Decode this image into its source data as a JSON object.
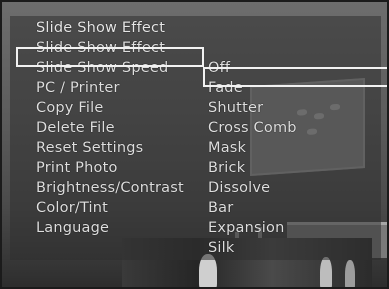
{
  "menu": {
    "title": "Slide Show Effect",
    "items": [
      {
        "label": "Slide Show Effect"
      },
      {
        "label": "Slide Show Speed"
      },
      {
        "label": "PC / Printer"
      },
      {
        "label": "Copy File"
      },
      {
        "label": "Delete File"
      },
      {
        "label": "Reset Settings"
      },
      {
        "label": "Print Photo"
      },
      {
        "label": "Brightness/Contrast"
      },
      {
        "label": "Color/Tint"
      },
      {
        "label": "Language"
      }
    ],
    "options": [
      {
        "label": "Off"
      },
      {
        "label": "Fade"
      },
      {
        "label": "Shutter"
      },
      {
        "label": "Cross Comb"
      },
      {
        "label": "Mask"
      },
      {
        "label": "Brick"
      },
      {
        "label": "Dissolve"
      },
      {
        "label": "Bar"
      },
      {
        "label": "Expansion"
      },
      {
        "label": "Silk"
      }
    ],
    "selected_item": "Slide Show Effect",
    "selected_option": "Off"
  }
}
